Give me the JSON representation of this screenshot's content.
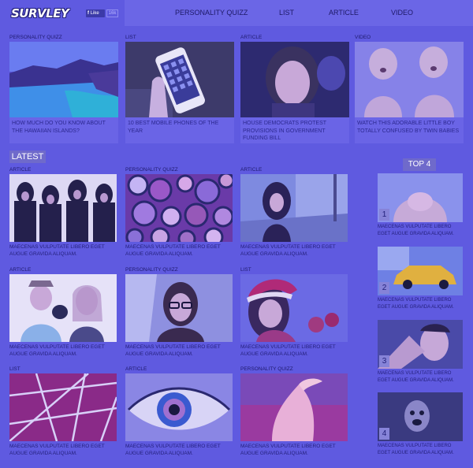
{
  "header": {
    "logo": "SURVLEY",
    "fb_like_label": "Like",
    "fb_count": "16k",
    "nav": [
      "PERSONALITY QUIZZ",
      "LIST",
      "ARTICLE",
      "VIDEO"
    ]
  },
  "featured": [
    {
      "category": "PERSONALITY QUIZZ",
      "caption": "HOW MUCH DO YOU KNOW ABOUT THE HAWAIIAN ISLANDS?"
    },
    {
      "category": "LIST",
      "caption": "10 BEST MOBILE PHONES OF THE YEAR"
    },
    {
      "category": "ARTICLE",
      "caption": "HOUSE DEMOCRATS PROTEST PROVISIONS IN GOVERNMENT FUNDING BILL"
    },
    {
      "category": "VIDEO",
      "caption": "WATCH THIS ADORABLE LITTLE BOY TOTALLY CONFUSED BY TWIN BABIES"
    }
  ],
  "latest": {
    "heading": "LATEST",
    "items": [
      {
        "category": "ARTICLE",
        "caption": "MAECENAS VULPUTATE LIBERO EGET AUGUE GRAVIDA ALIQUAM."
      },
      {
        "category": "PERSONALITY QUIZZ",
        "caption": "MAECENAS VULPUTATE LIBERO EGET AUGUE GRAVIDA ALIQUAM."
      },
      {
        "category": "ARTICLE",
        "caption": "MAECENAS VULPUTATE LIBERO EGET AUGUE GRAVIDA ALIQUAM."
      },
      {
        "category": "ARTICLE",
        "caption": "MAECENAS VULPUTATE LIBERO EGET AUGUE GRAVIDA ALIQUAM."
      },
      {
        "category": "PERSONALITY QUIZZ",
        "caption": "MAECENAS VULPUTATE LIBERO EGET AUGUE GRAVIDA ALIQUAM."
      },
      {
        "category": "LIST",
        "caption": "MAECENAS VULPUTATE LIBERO EGET AUGUE GRAVIDA ALIQUAM."
      },
      {
        "category": "LIST",
        "caption": "MAECENAS VULPUTATE LIBERO EGET AUGUE GRAVIDA ALIQUAM."
      },
      {
        "category": "ARTICLE",
        "caption": "MAECENAS VULPUTATE LIBERO EGET AUGUE GRAVIDA ALIQUAM."
      },
      {
        "category": "PERSONALITY QUIZZ",
        "caption": "MAECENAS VULPUTATE LIBERO EGET AUGUE GRAVIDA ALIQUAM."
      }
    ]
  },
  "top4": {
    "heading": "TOP 4",
    "items": [
      {
        "rank": "1",
        "caption": "MAECENAS VULPUTATE LIBERO EGET AUGUE GRAVIDA ALIQUAM."
      },
      {
        "rank": "2",
        "caption": "MAECENAS VULPUTATE LIBERO EGET AUGUE GRAVIDA ALIQUAM."
      },
      {
        "rank": "3",
        "caption": "MAECENAS VULPUTATE LIBERO EGET AUGUE GRAVIDA ALIQUAM."
      },
      {
        "rank": "4",
        "caption": "MAECENAS VULPUTATE LIBERO EGET AUGUE GRAVIDA ALIQUAM."
      }
    ]
  },
  "colors": {
    "background": "#5f5ae0",
    "nav_bar": "#6b66e6",
    "text": "#1a1660"
  }
}
